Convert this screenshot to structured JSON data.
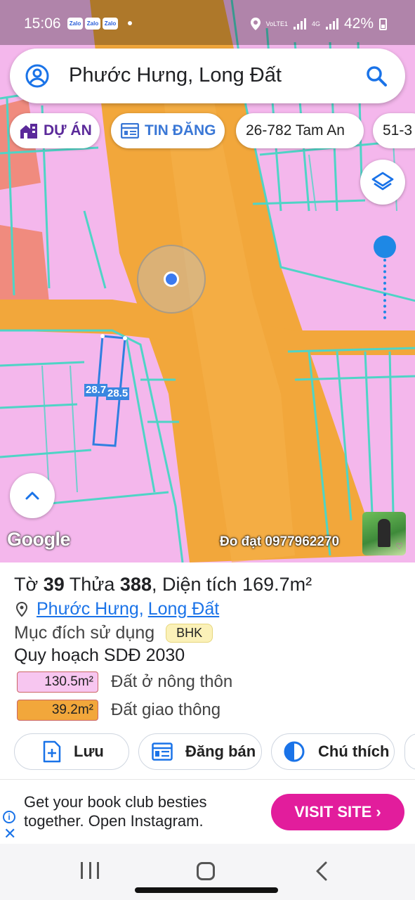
{
  "status_bar": {
    "time": "15:06",
    "zalo_label": "Zalo",
    "volte_label": "VoLTE1",
    "network": "4G",
    "battery": "42%"
  },
  "search": {
    "title": "Phước Hưng, Long Đất"
  },
  "chips": {
    "du_an": "DỰ ÁN",
    "tin_dang": "TIN ĐĂNG",
    "tam_an": "26-782 Tam An",
    "more": "51-3"
  },
  "map": {
    "google_label": "Google",
    "watermark": "Đo đạt 0977962270",
    "parcel_label_left": "28.7",
    "parcel_label_right": "28.5",
    "colors": {
      "residential": "#f4b7ec",
      "road": "#f2a73b",
      "boundary": "#4fd4c6"
    }
  },
  "parcel": {
    "prefix_to": "Tờ",
    "sheet": "39",
    "prefix_thua": "Thửa",
    "lot": "388",
    "area_label": ", Diện tích",
    "area_value": "169.7m²",
    "ward": "Phước Hưng",
    "separator": ",",
    "district": "Long Đất",
    "purpose_label": "Mục đích sử dụng",
    "purpose_code": "BHK",
    "plan_label": "Quy hoạch SDĐ 2030",
    "land_uses": [
      {
        "area": "130.5m²",
        "name": "Đất ở nông thôn",
        "color": "#f7c6f0"
      },
      {
        "area": "39.2m²",
        "name": "Đất giao thông",
        "color": "#f2a73b"
      }
    ]
  },
  "actions": {
    "save": "Lưu",
    "post_sale": "Đăng bán",
    "legend": "Chú thích"
  },
  "ad": {
    "text_line1": "Get your book club besties",
    "text_line2": "together. Open Instagram.",
    "cta": "VISIT SITE",
    "info_icon": "i",
    "close_icon": "✕"
  }
}
